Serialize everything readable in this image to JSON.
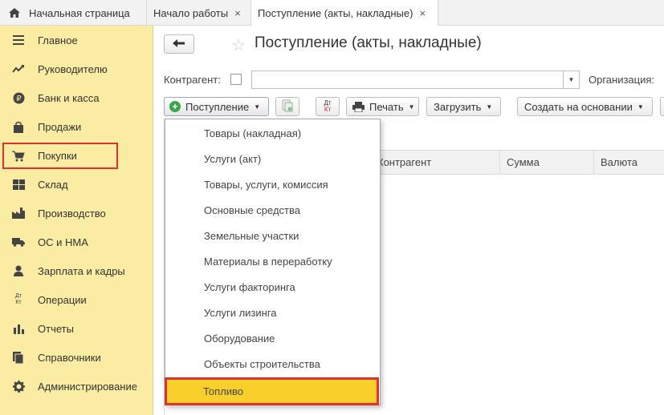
{
  "tabs": {
    "home_label": "Начальная страница",
    "tab1_label": "Начало работы",
    "tab2_label": "Поступление (акты, накладные)",
    "close_glyph": "×"
  },
  "sidebar": {
    "items": [
      {
        "label": "Главное",
        "icon": "menu-lines-icon"
      },
      {
        "label": "Руководителю",
        "icon": "trend-chart-icon"
      },
      {
        "label": "Банк и касса",
        "icon": "ruble-coin-icon"
      },
      {
        "label": "Продажи",
        "icon": "shopping-bag-icon"
      },
      {
        "label": "Покупки",
        "icon": "shopping-cart-icon"
      },
      {
        "label": "Склад",
        "icon": "warehouse-grid-icon"
      },
      {
        "label": "Производство",
        "icon": "factory-icon"
      },
      {
        "label": "ОС и НМА",
        "icon": "truck-icon"
      },
      {
        "label": "Зарплата и кадры",
        "icon": "person-icon"
      },
      {
        "label": "Операции",
        "icon": "dt-kt-icon"
      },
      {
        "label": "Отчеты",
        "icon": "bar-chart-icon"
      },
      {
        "label": "Справочники",
        "icon": "books-icon"
      },
      {
        "label": "Администрирование",
        "icon": "gear-icon"
      }
    ],
    "highlighted": "Покупки"
  },
  "main": {
    "title": "Поступление (акты, накладные)",
    "back_glyph": "🡐",
    "star_glyph": "☆",
    "filter": {
      "counterparty_label": "Контрагент:",
      "counterparty_value": "",
      "organization_label": "Организация:"
    },
    "toolbar": {
      "post_label": "Поступление",
      "print_label": "Печать",
      "load_label": "Загрузить",
      "create_based_label": "Создать на основании",
      "dt_label": "Дт",
      "kt_label": "Кт"
    },
    "table": {
      "columns": [
        "Контрагент",
        "Сумма",
        "Валюта"
      ]
    },
    "menu": {
      "items": [
        "Товары (накладная)",
        "Услуги (акт)",
        "Товары, услуги, комиссия",
        "Основные средства",
        "Земельные участки",
        "Материалы в переработку",
        "Услуги факторинга",
        "Услуги лизинга",
        "Оборудование",
        "Объекты строительства",
        "Топливо"
      ],
      "highlighted": "Топливо"
    }
  },
  "colors": {
    "sidebar_bg": "#fbeca3",
    "highlight_bg": "#f9cf2c",
    "highlight_border": "#e03030",
    "plus_green": "#3aa64a"
  }
}
